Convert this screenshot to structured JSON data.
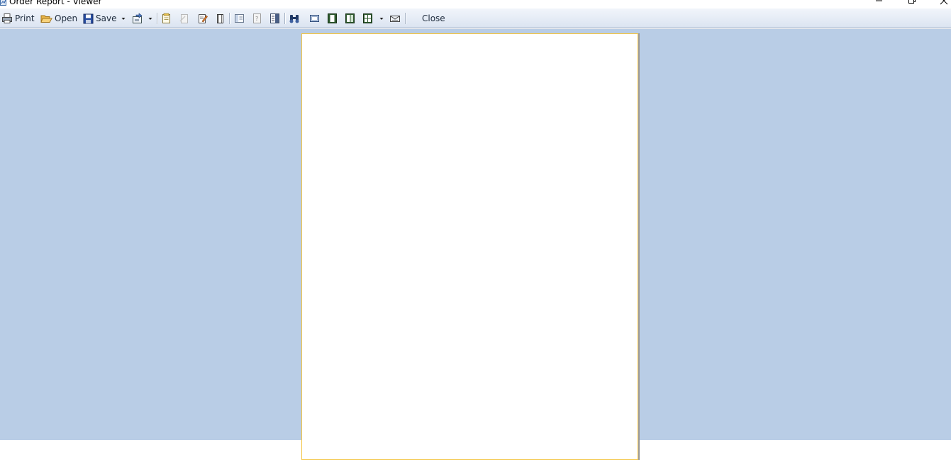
{
  "window": {
    "title": "Order Report - Viewer"
  },
  "toolbar": {
    "print_label": "Print",
    "open_label": "Open",
    "save_label": "Save",
    "close_label": "Close"
  },
  "icons": {
    "app": "report-icon",
    "print": "printer-icon",
    "open": "folder-open-icon",
    "save": "floppy-disk-icon",
    "export": "export-icon",
    "find": "binoculars-icon",
    "minimize": "minimize-icon",
    "maximize": "restore-icon",
    "close": "close-icon"
  },
  "colors": {
    "viewer_background": "#b9cde6",
    "page_border": "#f3c545",
    "toolbar_top": "#f1f5fb",
    "toolbar_bottom": "#dbe4f1"
  }
}
